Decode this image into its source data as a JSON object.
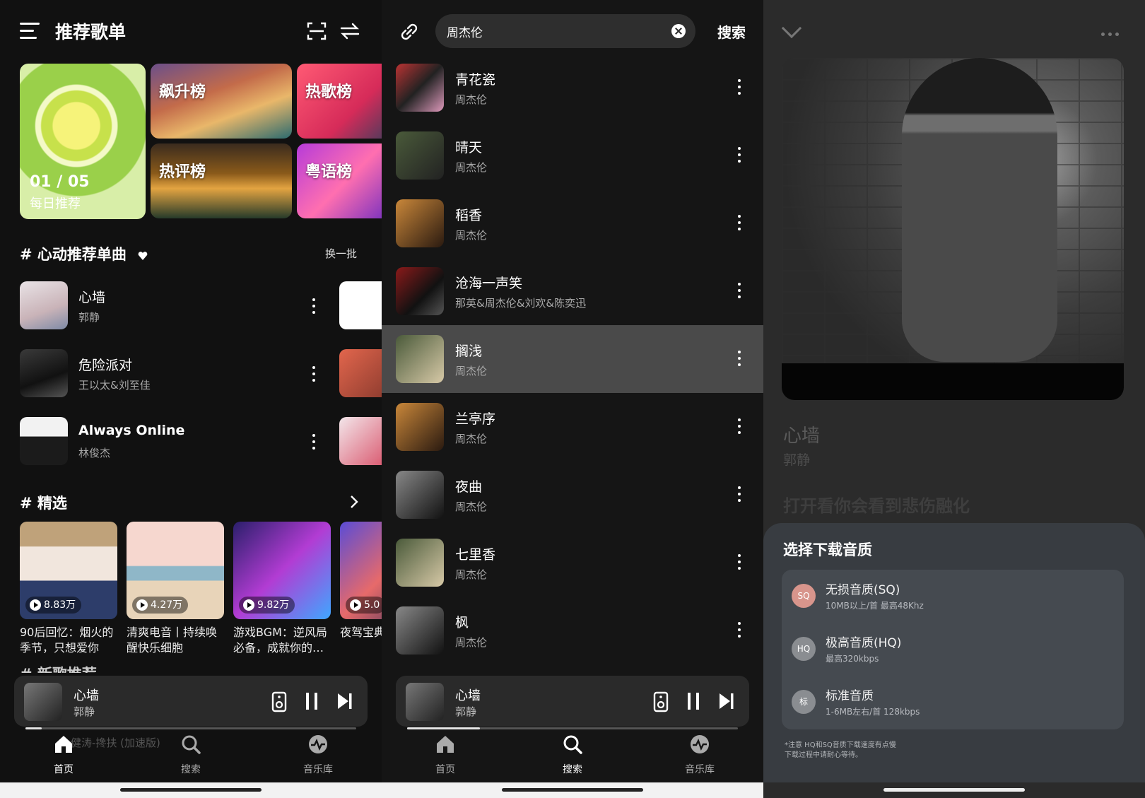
{
  "home": {
    "title": "推荐歌单",
    "banner_main": {
      "counter": "01 / 05",
      "label": "每日推荐"
    },
    "banner_rise": "飙升榜",
    "banner_hot": "热歌榜",
    "banner_comment": "热评榜",
    "banner_canto": "粤语榜",
    "recommend_heading": "# 心动推荐单曲",
    "refresh_label": "换一批",
    "songs": [
      {
        "name": "心墙",
        "artist": "郭静"
      },
      {
        "name": "危险派对",
        "artist": "王以太&刘至佳"
      },
      {
        "name": "Always Online",
        "artist": "林俊杰"
      }
    ],
    "picks_heading": "# 精选",
    "picks": [
      {
        "plays": "8.83万",
        "desc": "90后回忆：烟火的季节，只想爱你"
      },
      {
        "plays": "4.27万",
        "desc": "清爽电音丨持续唤醒快乐细胞"
      },
      {
        "plays": "9.82万",
        "desc": "游戏BGM：逆风局必备，成就你的…"
      },
      {
        "plays": "5.0",
        "desc": "夜驾宝典电音之旅"
      }
    ],
    "next_heading_partial": "# 新歌推荐",
    "marquee_behind": "健涛-搀扶 (加速版)"
  },
  "player": {
    "name": "心墙",
    "artist": "郭静",
    "progress_home": 0.05,
    "progress_search": 0.22
  },
  "tabs": [
    "首页",
    "搜索",
    "音乐库"
  ],
  "search": {
    "query": "周杰伦",
    "button": "搜索",
    "results": [
      {
        "name": "青花瓷",
        "artist": "周杰伦"
      },
      {
        "name": "晴天",
        "artist": "周杰伦"
      },
      {
        "name": "稻香",
        "artist": "周杰伦"
      },
      {
        "name": "沧海一声笑",
        "artist": "那英&周杰伦&刘欢&陈奕迅"
      },
      {
        "name": "搁浅",
        "artist": "周杰伦"
      },
      {
        "name": "兰亭序",
        "artist": "周杰伦"
      },
      {
        "name": "夜曲",
        "artist": "周杰伦"
      },
      {
        "name": "七里香",
        "artist": "周杰伦"
      },
      {
        "name": "枫",
        "artist": "周杰伦"
      }
    ],
    "selected_index": 4
  },
  "nowplaying": {
    "title": "心墙",
    "artist": "郭静",
    "lyric": "打开看你会看到悲伤融化"
  },
  "download_sheet": {
    "title": "选择下载音质",
    "options": [
      {
        "badge": "SQ",
        "name": "无损音质(SQ)",
        "desc": "10MB以上/首 最高48Khz"
      },
      {
        "badge": "HQ",
        "name": "极高音质(HQ)",
        "desc": "最高320kbps"
      },
      {
        "badge": "标",
        "name": "标准音质",
        "desc": "1-6MB左右/首 128kbps"
      }
    ],
    "note_line1": "*注意 HQ和SQ音质下载速度有点慢",
    "note_line2": "下载过程中请耐心等待。"
  }
}
